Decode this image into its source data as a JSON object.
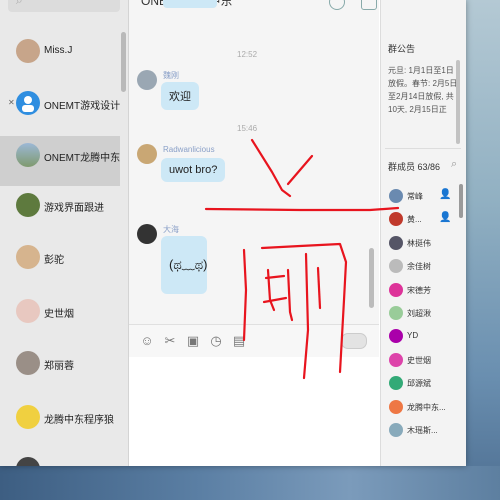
{
  "window": {
    "title": "ONEMT龙腾中东"
  },
  "conversations": [
    {
      "name": "Miss.J",
      "avatar_color": "#c7a58a"
    },
    {
      "name": "ONEMT游戏设计",
      "avatar_color": "#2f8ee0"
    },
    {
      "name": "ONEMT龙腾中东",
      "avatar_color": "#7f9a6e",
      "selected": true
    },
    {
      "name": "游戏界面跟进",
      "avatar_color": "#5e7a3e"
    },
    {
      "name": "彭驼",
      "avatar_color": "#d6b48e"
    },
    {
      "name": "史世烟",
      "avatar_color": "#e8c8c0"
    },
    {
      "name": "郑丽蓉",
      "avatar_color": "#9a8f87"
    },
    {
      "name": "龙腾中东程序狼",
      "avatar_color": "#f0d040"
    }
  ],
  "messages": [
    {
      "time": "12:52"
    },
    {
      "sender": "魏刚",
      "text": "欢迎",
      "avatar_color": "#9aa7b3"
    },
    {
      "time": "15:46"
    },
    {
      "sender": "Radwanlicious",
      "text": "uwot bro?",
      "avatar_color": "#c9a774"
    },
    {
      "sender": "大海",
      "sticker": "(ಥ﹏ಥ)",
      "avatar_color": "#333333"
    }
  ],
  "toolbar": {
    "icons": [
      "emoji-icon",
      "scissors-icon",
      "image-icon",
      "clock-icon",
      "folder-icon"
    ],
    "glyphs": [
      "☺",
      "✂",
      "▣",
      "◷",
      "▤"
    ]
  },
  "group": {
    "notice_label": "群公告",
    "notice_text": "元旦: 1月1日至1日放假。春节: 2月5日至2月14日放假, 共10天, 2月15日正",
    "members_label": "群成员 63/86",
    "members": [
      {
        "name": "常峰",
        "color": "#6a8ab0",
        "role": true
      },
      {
        "name": "黄...",
        "color": "#c0392b",
        "role": true
      },
      {
        "name": "林挺伟",
        "color": "#556"
      },
      {
        "name": "余佳树",
        "color": "#bbb"
      },
      {
        "name": "宋德芳",
        "color": "#d39"
      },
      {
        "name": "刘超湫",
        "color": "#9c9"
      },
      {
        "name": "YD",
        "color": "#a0a"
      },
      {
        "name": "史世烟",
        "color": "#d4a"
      },
      {
        "name": "邱源斌",
        "color": "#3a7"
      },
      {
        "name": "龙腾中东...",
        "color": "#e74"
      },
      {
        "name": "木瑶斯...",
        "color": "#8ab"
      }
    ]
  },
  "colors": {
    "ink": "#e8141e",
    "bubble": "#cde8f6",
    "sender": "#8aa0c8"
  }
}
